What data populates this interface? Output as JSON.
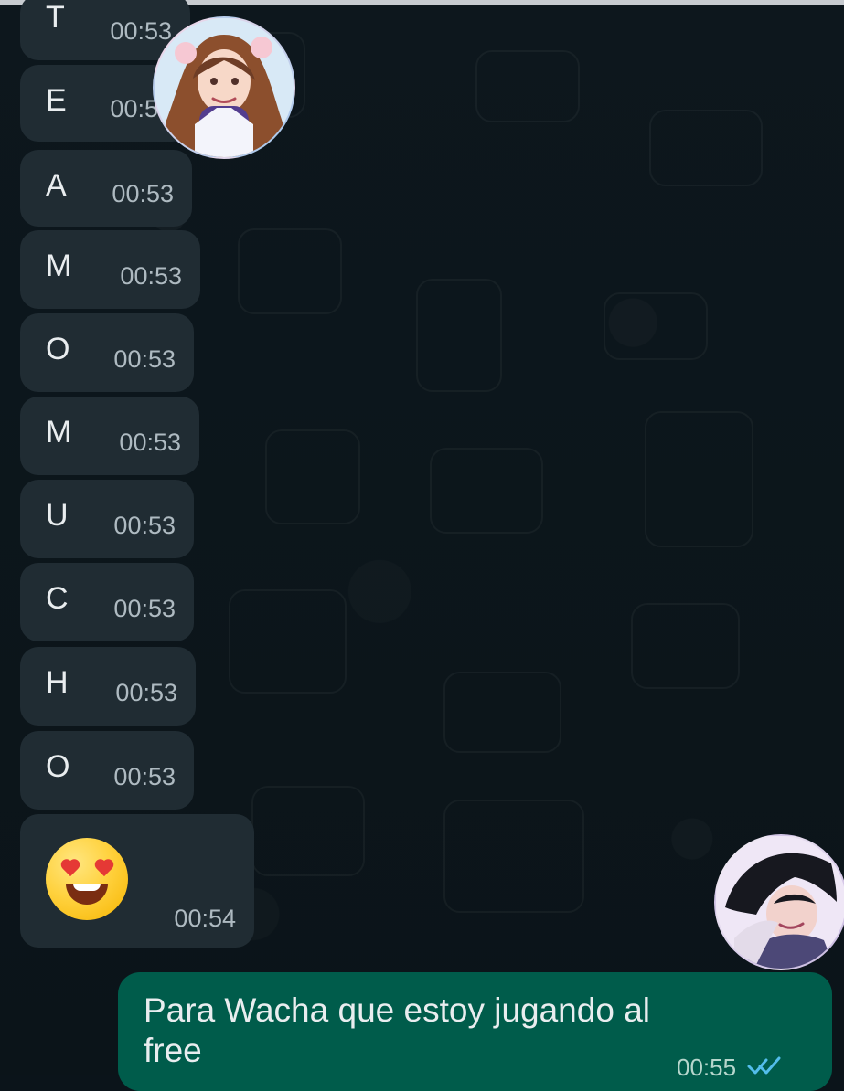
{
  "chat": {
    "incoming_messages": [
      {
        "text": "T",
        "time": "00:53"
      },
      {
        "text": "E",
        "time": "00:53"
      },
      {
        "text": "A",
        "time": "00:53"
      },
      {
        "text": "M",
        "time": "00:53"
      },
      {
        "text": "O",
        "time": "00:53"
      },
      {
        "text": "M",
        "time": "00:53"
      },
      {
        "text": "U",
        "time": "00:53"
      },
      {
        "text": "C",
        "time": "00:53"
      },
      {
        "text": "H",
        "time": "00:53"
      },
      {
        "text": "O",
        "time": "00:53"
      }
    ],
    "emoji_message": {
      "emoji_name": "smiling-face-with-heart-eyes",
      "time": "00:54"
    },
    "outgoing_message": {
      "text": "Para Wacha que estoy jugando al free",
      "time": "00:55",
      "status_icon": "double-check-icon"
    }
  },
  "colors": {
    "background": "#0b141a",
    "incoming_bubble": "#202c33",
    "outgoing_bubble": "#005c4b",
    "text": "#e9edef",
    "timestamp": "#aebac1",
    "read_check": "#53bdeb"
  }
}
